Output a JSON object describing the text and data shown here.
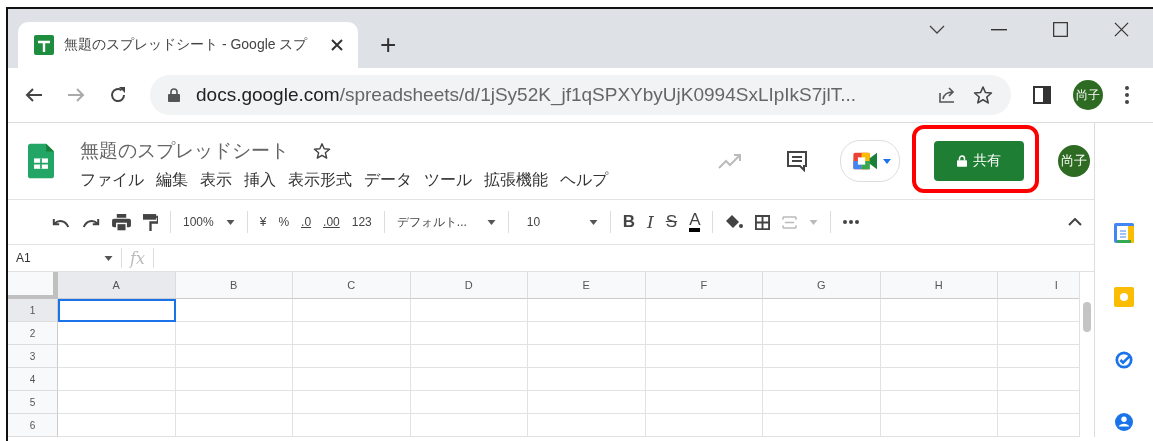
{
  "browser": {
    "tab": {
      "title": "無題のスプレッドシート - Google スプ",
      "selected": true
    },
    "new_tab": "+",
    "url_host": "docs.google.com",
    "url_path": "/spreadsheets/d/1jSy52K_jf1qSPXYbyUjK0994SxLIpIkS7jlT...",
    "profile": "尚子"
  },
  "sheet": {
    "title": "無題のスプレッドシート",
    "menus": [
      "ファイル",
      "編集",
      "表示",
      "挿入",
      "表示形式",
      "データ",
      "ツール",
      "拡張機能",
      "ヘルプ"
    ],
    "share": "共有",
    "profile": "尚子",
    "share_highlighted": true
  },
  "toolbar": {
    "zoom": "100%",
    "currency": "¥",
    "percent": "%",
    "decrease_decimals": ".0",
    "increase_decimals": ".00",
    "number_format": "123",
    "font": "デフォルト...",
    "font_size": "10",
    "bold": "B",
    "italic": "I",
    "strikethrough": "S",
    "text_color": "A"
  },
  "formula_bar": {
    "name_box": "A1",
    "fx": "fx"
  },
  "grid": {
    "columns": [
      {
        "label": "A",
        "selected": true
      },
      {
        "label": "B",
        "selected": false
      },
      {
        "label": "C",
        "selected": false
      },
      {
        "label": "D",
        "selected": false
      },
      {
        "label": "E",
        "selected": false
      },
      {
        "label": "F",
        "selected": false
      },
      {
        "label": "G",
        "selected": false
      },
      {
        "label": "H",
        "selected": false
      },
      {
        "label": "I",
        "selected": false
      }
    ],
    "rows": [
      {
        "label": "1",
        "selected": true
      },
      {
        "label": "2",
        "selected": false
      },
      {
        "label": "3",
        "selected": false
      },
      {
        "label": "4",
        "selected": false
      },
      {
        "label": "5",
        "selected": false
      },
      {
        "label": "6",
        "selected": false
      }
    ]
  }
}
